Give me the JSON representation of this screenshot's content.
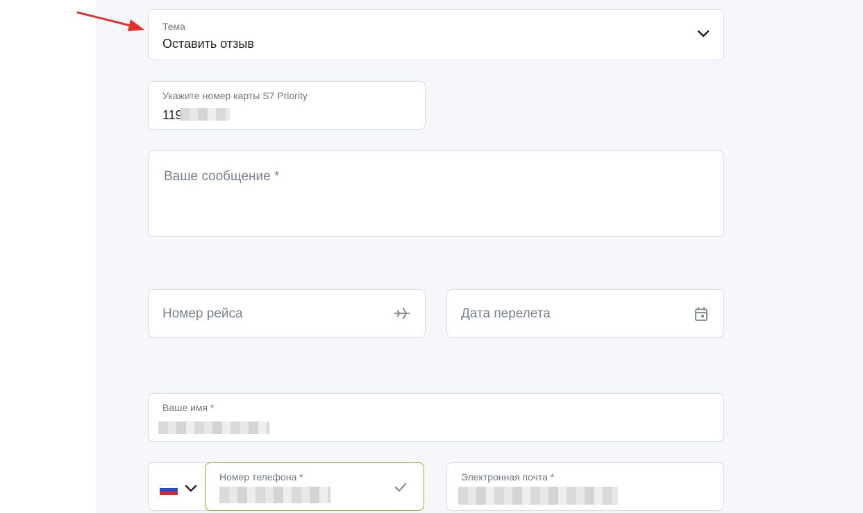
{
  "topic": {
    "label": "Тема",
    "value": "Оставить отзыв",
    "icon": "chevron-down-icon"
  },
  "priority_card": {
    "label": "Укажите номер карты S7 Priority",
    "value_visible": "119"
  },
  "message": {
    "placeholder": "Ваше сообщение *"
  },
  "flight_number": {
    "placeholder": "Номер рейса",
    "icon": "airplane-icon"
  },
  "flight_date": {
    "placeholder": "Дата перелета",
    "icon": "calendar-icon"
  },
  "name": {
    "label": "Ваше имя *"
  },
  "phone": {
    "label": "Номер телефона *",
    "country_icon": "russia-flag-icon",
    "status_icon": "check-icon",
    "accent": "#8ab32a"
  },
  "email": {
    "label": "Электронная почта *"
  },
  "annotation": {
    "icon": "red-arrow-icon",
    "color": "#e1322d"
  }
}
